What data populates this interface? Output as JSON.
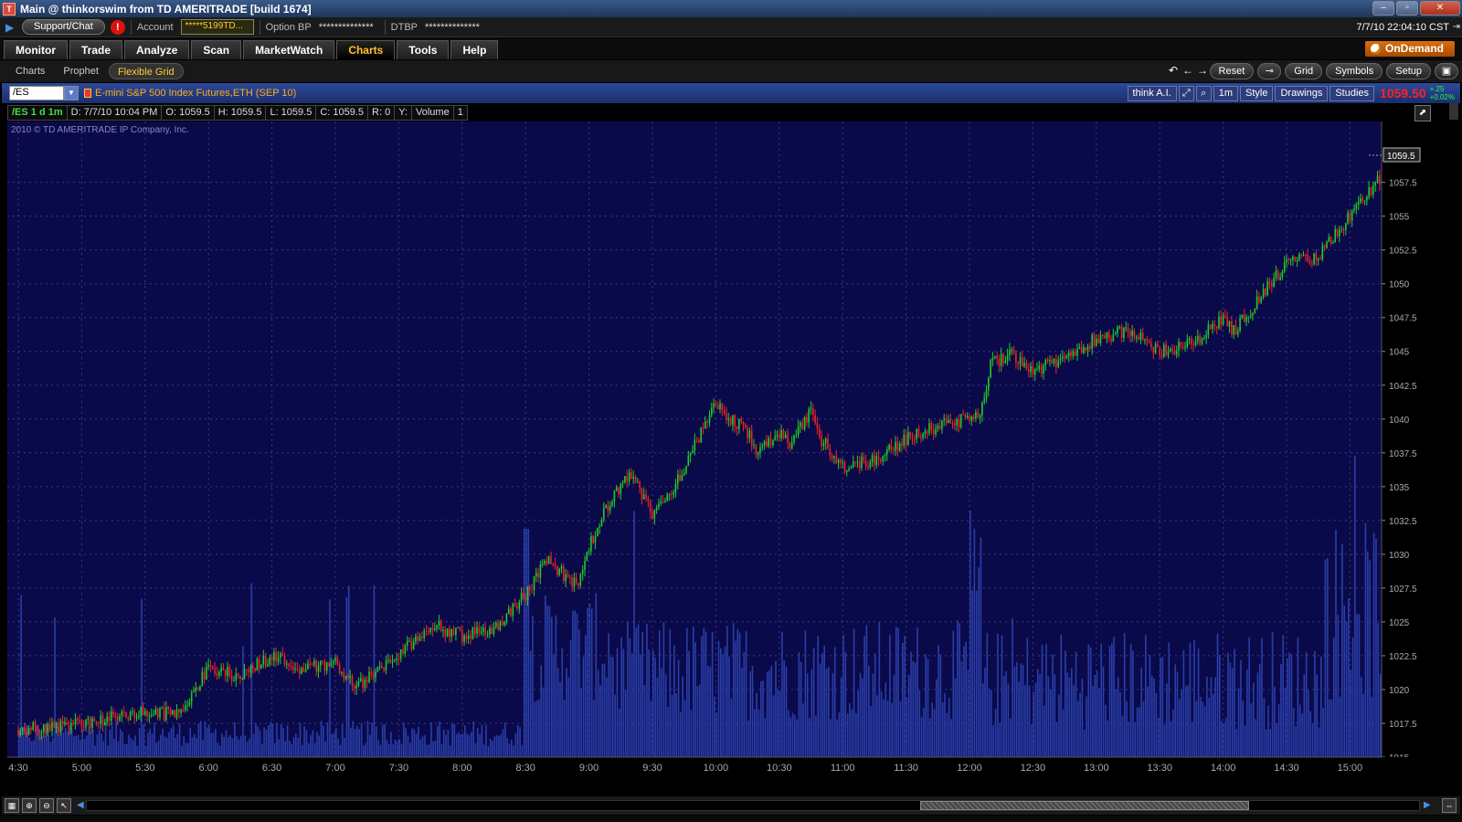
{
  "window": {
    "title": "Main @ thinkorswim from TD AMERITRADE [build 1674]",
    "controls": [
      "–",
      "▫",
      "✕"
    ]
  },
  "accountbar": {
    "support_label": "Support/Chat",
    "alert_label": "!",
    "account_label": "Account",
    "account_value": "*****5199TD...",
    "option_bp_label": "Option BP",
    "option_bp_value": "**************",
    "dtbp_label": "DTBP",
    "dtbp_value": "**************",
    "clock": "7/7/10 22:04:10 CST"
  },
  "main_tabs": [
    {
      "label": "Monitor",
      "active": false
    },
    {
      "label": "Trade",
      "active": false
    },
    {
      "label": "Analyze",
      "active": false
    },
    {
      "label": "Scan",
      "active": false
    },
    {
      "label": "MarketWatch",
      "active": false
    },
    {
      "label": "Charts",
      "active": true
    },
    {
      "label": "Tools",
      "active": false
    },
    {
      "label": "Help",
      "active": false
    }
  ],
  "ondemand_label": "OnDemand",
  "sub_tabs": [
    {
      "label": "Charts",
      "active": false
    },
    {
      "label": "Prophet",
      "active": false
    },
    {
      "label": "Flexible Grid",
      "active": true
    }
  ],
  "chart_toolbar": {
    "reset": "Reset",
    "grid": "Grid",
    "symbols": "Symbols",
    "setup": "Setup"
  },
  "symbol_bar": {
    "symbol": "/ES",
    "description": "E-mini S&P 500 Index Futures,ETH (SEP 10)",
    "think_ai": "think A.I.",
    "timeframe": "1m",
    "style": "Style",
    "drawings": "Drawings",
    "studies": "Studies",
    "last_price": "1059.50",
    "change_top": "+.25",
    "change_bottom": "+0.02%"
  },
  "quote_bar": {
    "symbol_period": "/ES 1 d 1m",
    "date": "D: 7/7/10 10:04 PM",
    "open": "O: 1059.5",
    "high": "H: 1059.5",
    "low": "L: 1059.5",
    "close": "C: 1059.5",
    "range": "R: 0",
    "y": "Y:",
    "volume_label": "Volume",
    "volume_value": "1"
  },
  "copyright": "2010 © TD AMERITRADE IP Company, Inc.",
  "chart_data": {
    "type": "candlestick",
    "title": "",
    "xlabel": "",
    "ylabel": "",
    "ylim": [
      1015,
      1062
    ],
    "yticks": [
      "1057.5",
      "1055",
      "1052.5",
      "1050",
      "1047.5",
      "1045",
      "1042.5",
      "1040",
      "1037.5",
      "1035",
      "1032.5",
      "1030",
      "1027.5",
      "1025",
      "1022.5",
      "1020",
      "1017.5",
      "1015"
    ],
    "ytick_values": [
      1057.5,
      1055,
      1052.5,
      1050,
      1047.5,
      1045,
      1042.5,
      1040,
      1037.5,
      1035,
      1032.5,
      1030,
      1027.5,
      1025,
      1022.5,
      1020,
      1017.5,
      1015
    ],
    "xticks": [
      "4:30",
      "5:00",
      "5:30",
      "6:00",
      "6:30",
      "7:00",
      "7:30",
      "8:00",
      "8:30",
      "9:00",
      "9:30",
      "10:00",
      "10:30",
      "11:00",
      "11:30",
      "12:00",
      "12:30",
      "13:00",
      "13:30",
      "14:00",
      "14:30",
      "15:00"
    ],
    "x_start_time": "4:30",
    "current_price_label": "1059.5",
    "up_color": "#22cc22",
    "down_color": "#ee2222",
    "background_color": "#0a0a4a",
    "volume_color": "#2a3ea8",
    "close_path": [
      [
        "4:30",
        1017
      ],
      [
        "5:00",
        1017.5
      ],
      [
        "5:30",
        1018.3
      ],
      [
        "5:45",
        1018.2
      ],
      [
        "6:00",
        1021.5
      ],
      [
        "6:15",
        1021
      ],
      [
        "6:30",
        1022.5
      ],
      [
        "6:45",
        1021.5
      ],
      [
        "7:00",
        1022
      ],
      [
        "7:10",
        1020.2
      ],
      [
        "7:30",
        1022.5
      ],
      [
        "7:45",
        1024.8
      ],
      [
        "8:00",
        1024
      ],
      [
        "8:15",
        1024.5
      ],
      [
        "8:30",
        1027
      ],
      [
        "8:40",
        1029.7
      ],
      [
        "8:55",
        1027.5
      ],
      [
        "9:00",
        1030.5
      ],
      [
        "9:10",
        1034
      ],
      [
        "9:20",
        1035.8
      ],
      [
        "9:30",
        1033
      ],
      [
        "9:40",
        1035
      ],
      [
        "9:50",
        1038
      ],
      [
        "10:00",
        1041
      ],
      [
        "10:15",
        1039
      ],
      [
        "10:20",
        1037.5
      ],
      [
        "10:30",
        1039
      ],
      [
        "10:35",
        1038
      ],
      [
        "10:45",
        1040.5
      ],
      [
        "10:50",
        1038.5
      ],
      [
        "11:00",
        1036.5
      ],
      [
        "11:15",
        1037
      ],
      [
        "11:30",
        1038.5
      ],
      [
        "11:45",
        1039.5
      ],
      [
        "12:00",
        1040
      ],
      [
        "12:05",
        1040.5
      ],
      [
        "12:10",
        1044
      ],
      [
        "12:20",
        1045
      ],
      [
        "12:30",
        1043.5
      ],
      [
        "12:45",
        1044.5
      ],
      [
        "13:00",
        1046
      ],
      [
        "13:15",
        1046.5
      ],
      [
        "13:30",
        1045
      ],
      [
        "13:45",
        1045.5
      ],
      [
        "14:00",
        1047.5
      ],
      [
        "14:05",
        1046.5
      ],
      [
        "14:15",
        1048.5
      ],
      [
        "14:30",
        1051.5
      ],
      [
        "14:45",
        1052
      ],
      [
        "15:00",
        1055
      ],
      [
        "15:15",
        1058
      ],
      [
        "15:20",
        1059.5
      ]
    ],
    "series": [
      {
        "name": "Volume",
        "note": "volume histogram overlay, spikes near 8:30 open, 12:00, and 15:00"
      }
    ]
  }
}
